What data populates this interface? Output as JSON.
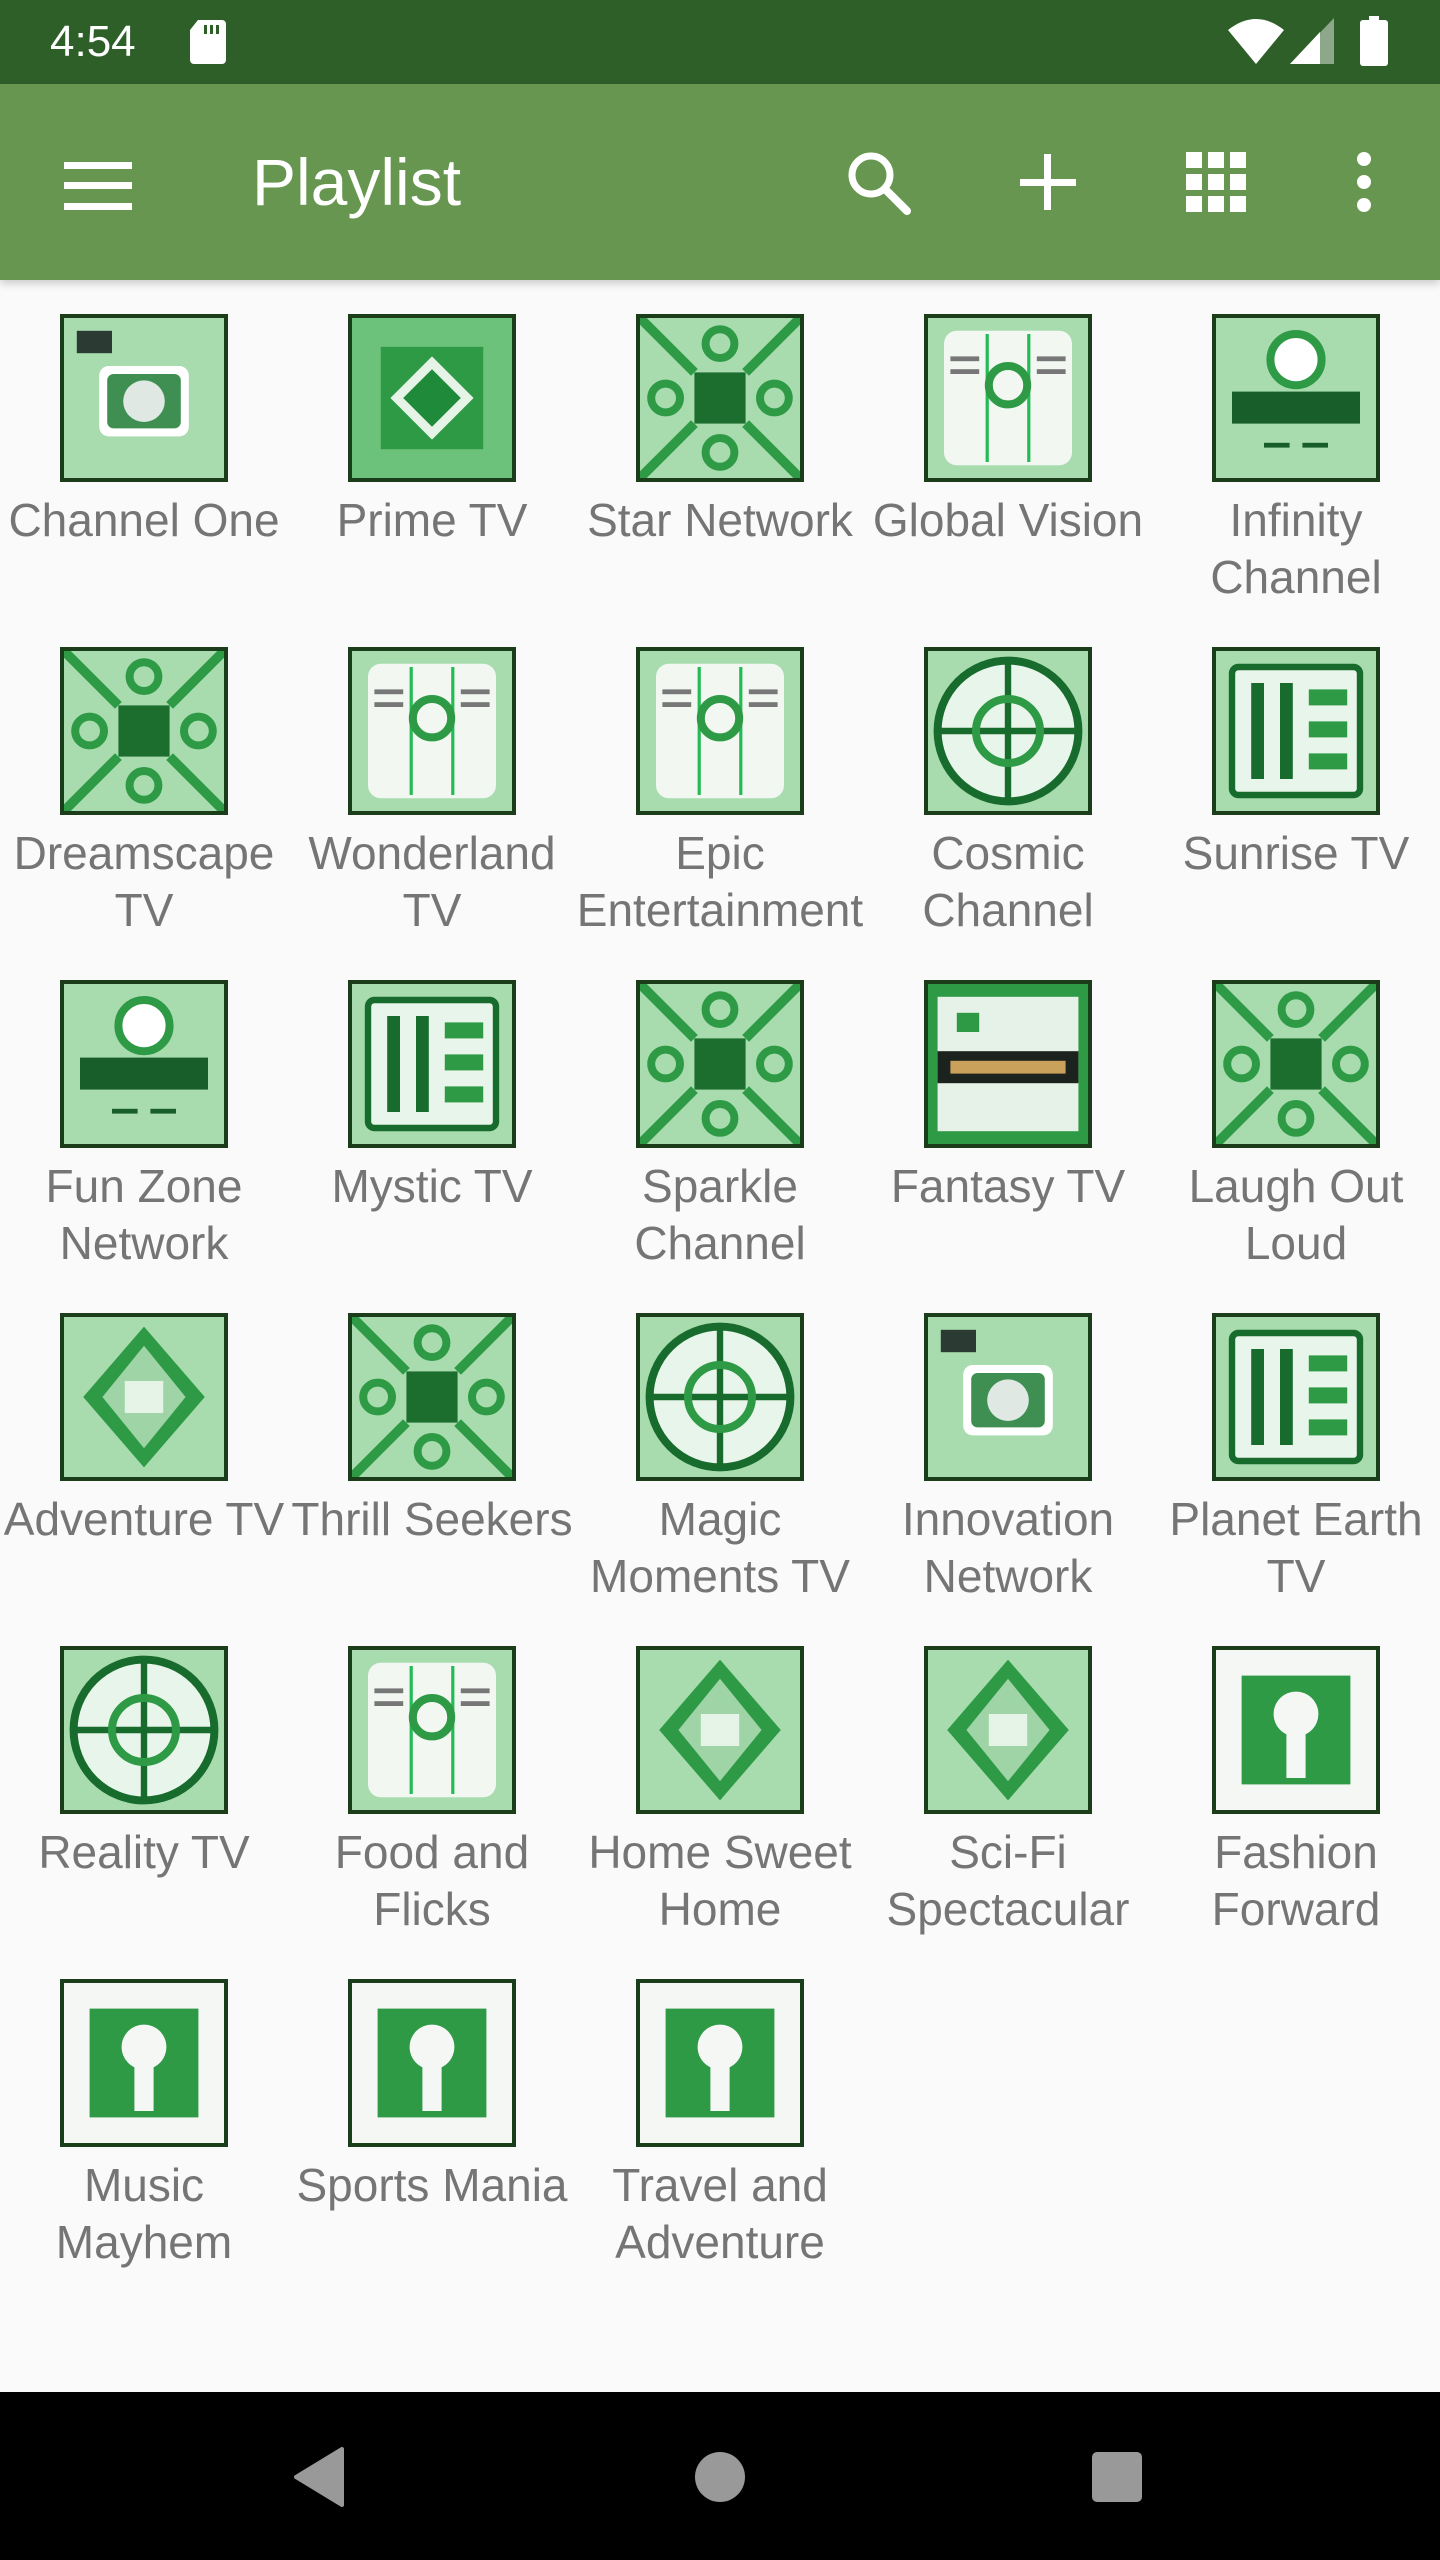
{
  "status_bar": {
    "time": "4:54",
    "icons": [
      "sd-card-icon",
      "wifi-icon",
      "cell-signal-icon",
      "battery-icon"
    ]
  },
  "toolbar": {
    "title": "Playlist",
    "actions": [
      {
        "name": "menu",
        "icon": "hamburger-menu-icon"
      },
      {
        "name": "search",
        "icon": "search-icon"
      },
      {
        "name": "add",
        "icon": "plus-icon"
      },
      {
        "name": "view",
        "icon": "grid-view-icon"
      },
      {
        "name": "more",
        "icon": "more-vert-icon"
      }
    ]
  },
  "colors": {
    "status_bar": "#2f5f29",
    "toolbar": "#66964f",
    "background": "#fafafa",
    "label_text": "#757575",
    "tile_border": "#1b3d1a",
    "tile_green": "#2e9a45",
    "tile_light": "#a8dcae"
  },
  "channels": [
    {
      "name": "Channel One",
      "style": 0
    },
    {
      "name": "Prime TV",
      "style": 1
    },
    {
      "name": "Star Network",
      "style": 2
    },
    {
      "name": "Global Vision",
      "style": 3
    },
    {
      "name": "Infinity Channel",
      "style": 4
    },
    {
      "name": "Dreamscape TV",
      "style": 2
    },
    {
      "name": "Wonderland TV",
      "style": 3
    },
    {
      "name": "Epic Entertainment",
      "style": 3
    },
    {
      "name": "Cosmic Channel",
      "style": 5
    },
    {
      "name": "Sunrise TV",
      "style": 6
    },
    {
      "name": "Fun Zone Network",
      "style": 4
    },
    {
      "name": "Mystic TV",
      "style": 6
    },
    {
      "name": "Sparkle Channel",
      "style": 2
    },
    {
      "name": "Fantasy TV",
      "style": 7
    },
    {
      "name": "Laugh Out Loud",
      "style": 2
    },
    {
      "name": "Adventure TV",
      "style": 8
    },
    {
      "name": "Thrill Seekers",
      "style": 2
    },
    {
      "name": "Magic Moments TV",
      "style": 5
    },
    {
      "name": "Innovation Network",
      "style": 0
    },
    {
      "name": "Planet Earth TV",
      "style": 6
    },
    {
      "name": "Reality TV",
      "style": 5
    },
    {
      "name": "Food and Flicks",
      "style": 3
    },
    {
      "name": "Home Sweet Home",
      "style": 8
    },
    {
      "name": "Sci-Fi Spectacular",
      "style": 8
    },
    {
      "name": "Fashion Forward",
      "style": 9
    },
    {
      "name": "Music Mayhem",
      "style": 9
    },
    {
      "name": "Sports Mania",
      "style": 9
    },
    {
      "name": "Travel and Adventure",
      "style": 9
    }
  ],
  "nav_bar": {
    "buttons": [
      {
        "name": "back",
        "icon": "back-triangle-icon"
      },
      {
        "name": "home",
        "icon": "home-circle-icon"
      },
      {
        "name": "recents",
        "icon": "recents-square-icon"
      }
    ]
  }
}
